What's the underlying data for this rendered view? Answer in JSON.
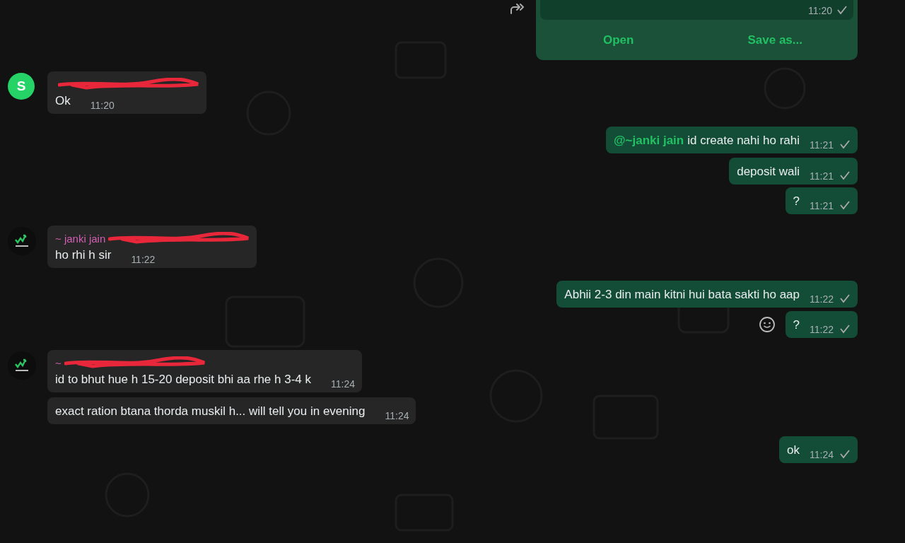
{
  "document_card": {
    "time": "11:20",
    "sent_tick": true,
    "actions": [
      "Open",
      "Save as..."
    ]
  },
  "messages": [
    {
      "kind": "incoming",
      "avatar": {
        "kind": "letter",
        "letter": "S"
      },
      "sender_redacted": true,
      "text": "Ok",
      "time": "11:20"
    },
    {
      "kind": "outgoing",
      "mention": "@~janki jain",
      "text": "id create nahi ho rahi",
      "time": "11:21",
      "sent_tick": true
    },
    {
      "kind": "outgoing",
      "text": "deposit wali",
      "time": "11:21",
      "sent_tick": true
    },
    {
      "kind": "outgoing",
      "text": "?",
      "time": "11:21",
      "sent_tick": true
    },
    {
      "kind": "incoming",
      "avatar": {
        "kind": "logo"
      },
      "sender": "~ janki jain",
      "sender_redacted": true,
      "text": "ho rhi h sir",
      "time": "11:22"
    },
    {
      "kind": "outgoing",
      "text": "Abhii 2-3 din main kitni hui bata sakti ho aap",
      "time": "11:22",
      "sent_tick": true
    },
    {
      "kind": "outgoing",
      "text": "?",
      "time": "11:22",
      "sent_tick": true,
      "emoji_button": true
    },
    {
      "kind": "incoming",
      "avatar": {
        "kind": "logo"
      },
      "sender": "~",
      "sender_redacted": true,
      "text": "id to bhut hue h 15-20 deposit bhi aa rhe h 3-4 k",
      "time": "11:24"
    },
    {
      "kind": "incoming",
      "text": "exact ration btana thorda muskil h... will tell you in evening",
      "time": "11:24"
    },
    {
      "kind": "outgoing",
      "text": "ok",
      "time": "11:24",
      "sent_tick": true
    }
  ]
}
